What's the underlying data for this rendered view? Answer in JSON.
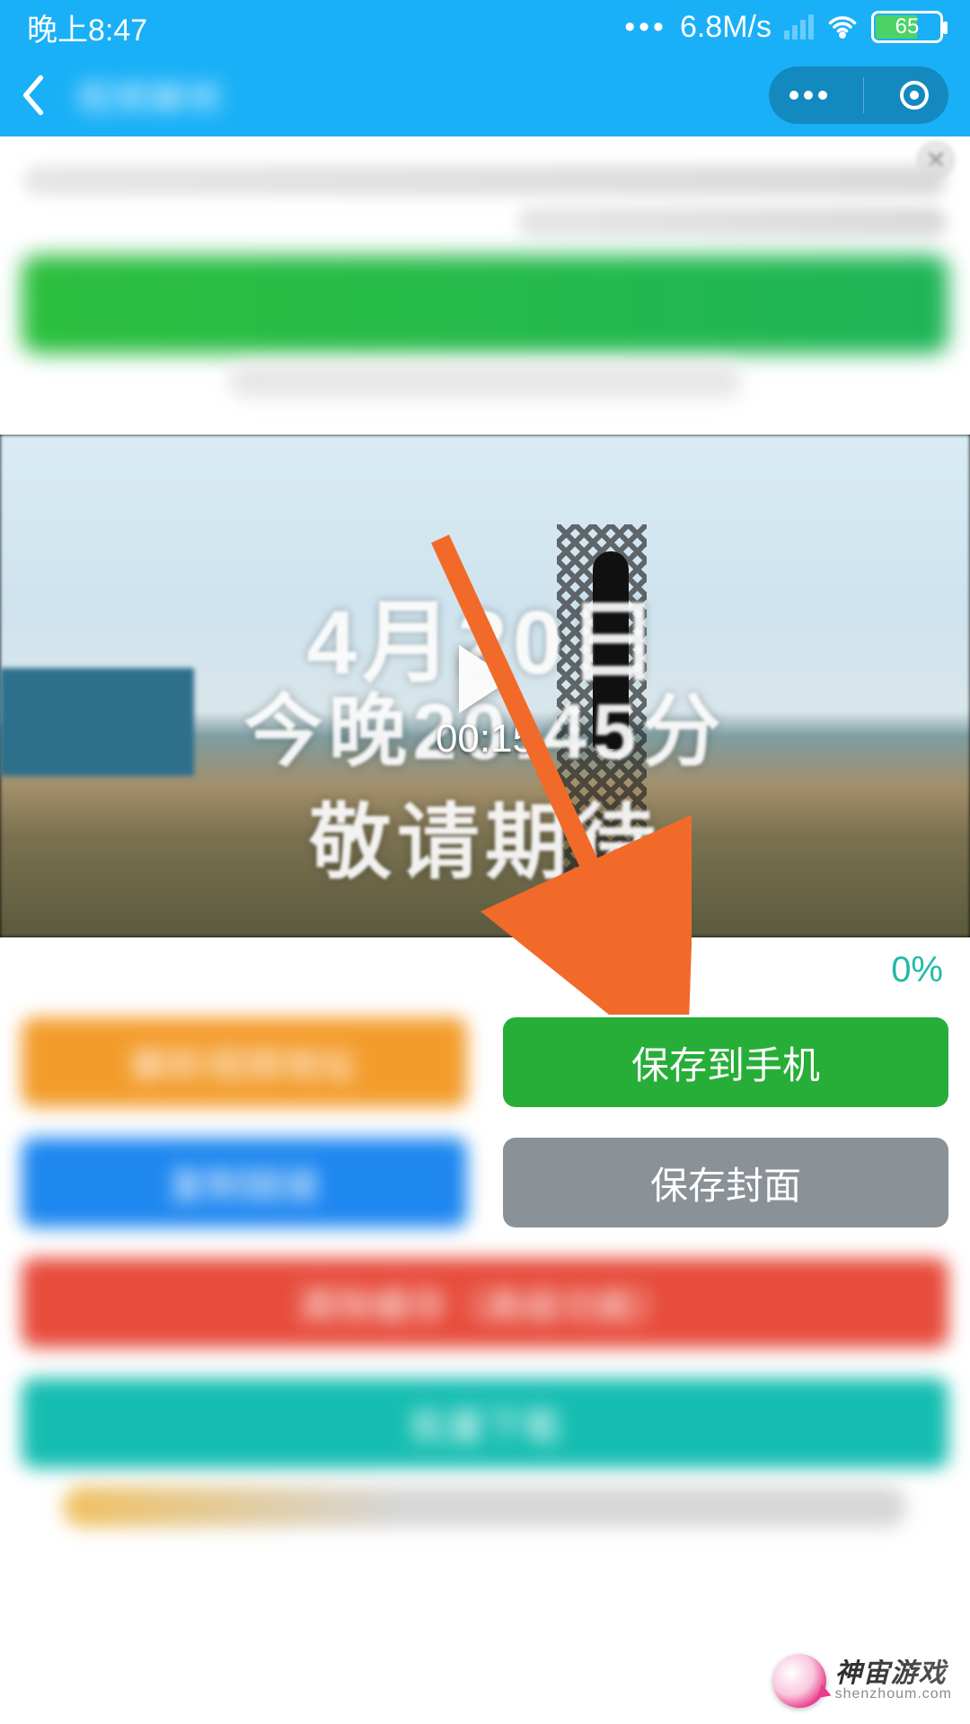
{
  "status": {
    "time": "晚上8:47",
    "net_speed": "6.8M/s",
    "battery_pct": "65"
  },
  "nav": {
    "title_blurred": "视频解析"
  },
  "video": {
    "overlay_line1": "4月20日",
    "overlay_line2": "今晚20:45分",
    "overlay_line3": "敬请期待",
    "duration": "00:15"
  },
  "progress": {
    "percent_label": "0%"
  },
  "buttons": {
    "orange_blurred": "解析视频地址",
    "save_phone": "保存到手机",
    "blue_blurred": "复制链接",
    "save_cover": "保存封面",
    "red_blurred": "清除缓存（高级功能）",
    "teal_blurred": "批量下载"
  },
  "watermark": {
    "main": "神宙游戏",
    "sub": "shenzhoum.com"
  },
  "icons": {
    "back": "chevron-left-icon",
    "more": "more-icon",
    "target": "target-icon",
    "wifi": "wifi-icon",
    "signal": "signal-icon",
    "battery": "battery-icon",
    "close": "close-icon",
    "play": "play-icon"
  },
  "colors": {
    "primary": "#19B0F7",
    "green": "#27AE38",
    "orange": "#F39C2C",
    "blue": "#1E87F0",
    "gray": "#8A9197",
    "red": "#E74C3C",
    "teal": "#15BDB1",
    "arrow": "#F26A2A"
  }
}
